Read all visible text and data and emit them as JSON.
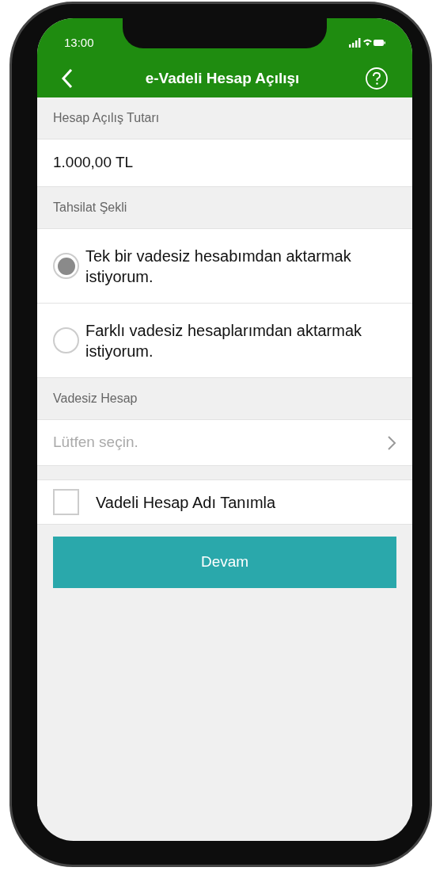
{
  "status_bar": {
    "time": "13:00"
  },
  "header": {
    "title": "e-Vadeli Hesap Açılışı"
  },
  "amount": {
    "label": "Hesap Açılış Tutarı",
    "value": "1.000,00 TL"
  },
  "collection": {
    "label": "Tahsilat Şekli",
    "options": [
      {
        "label": "Tek bir vadesiz hesabımdan aktarmak istiyorum.",
        "selected": true
      },
      {
        "label": "Farklı vadesiz hesaplarımdan aktarmak istiyorum.",
        "selected": false
      }
    ]
  },
  "account": {
    "label": "Vadesiz Hesap",
    "placeholder": "Lütfen seçin."
  },
  "name_option": {
    "label": "Vadeli Hesap Adı Tanımla",
    "checked": false
  },
  "continue_button": {
    "label": "Devam"
  }
}
